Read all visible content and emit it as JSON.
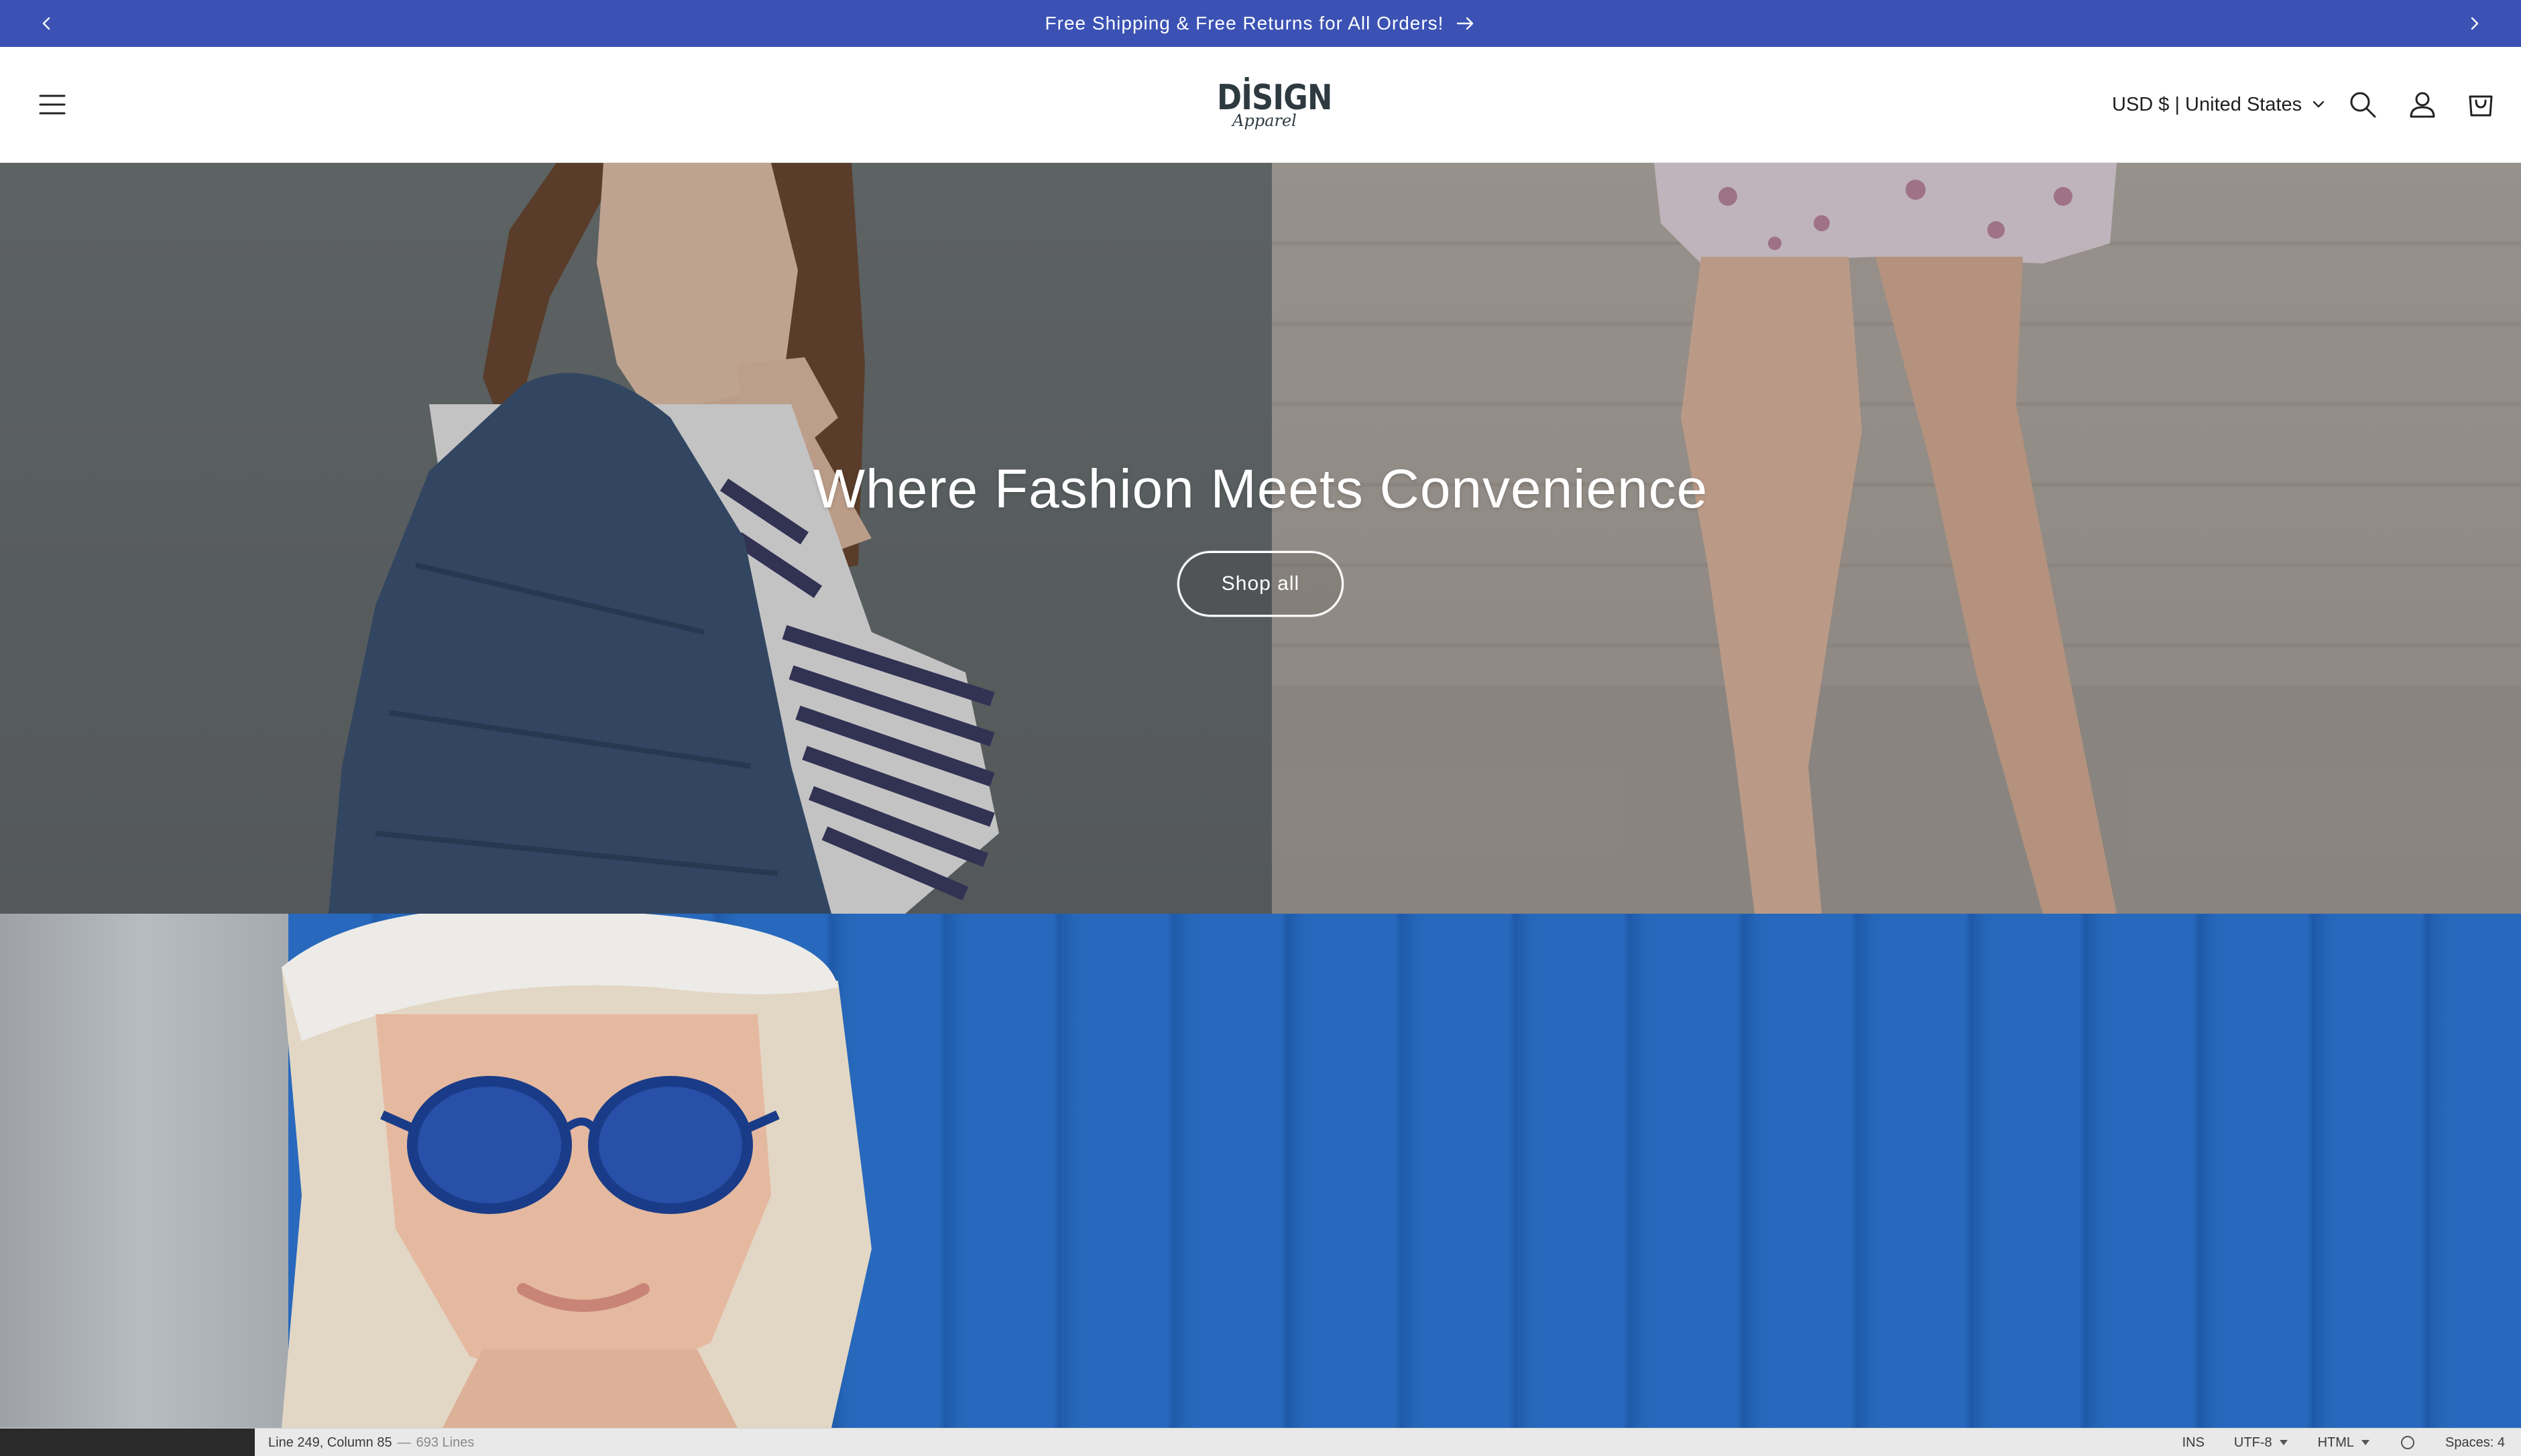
{
  "announcement": {
    "text": "Free Shipping & Free Returns for All Orders!",
    "background": "#3b52b4"
  },
  "header": {
    "logo_main": "DİSIGN",
    "logo_sub": "Apparel",
    "currency": "USD $ | United States",
    "icons": [
      "menu-icon",
      "search-icon",
      "account-icon",
      "cart-icon"
    ]
  },
  "hero": {
    "title": "Where Fashion Meets Convenience",
    "button_label": "Shop all"
  },
  "statusbar": {
    "position": "Line 249, Column 85",
    "separator": "—",
    "lines": "693 Lines",
    "mode": "INS",
    "encoding": "UTF-8",
    "language": "HTML",
    "indent": "Spaces: 4"
  }
}
